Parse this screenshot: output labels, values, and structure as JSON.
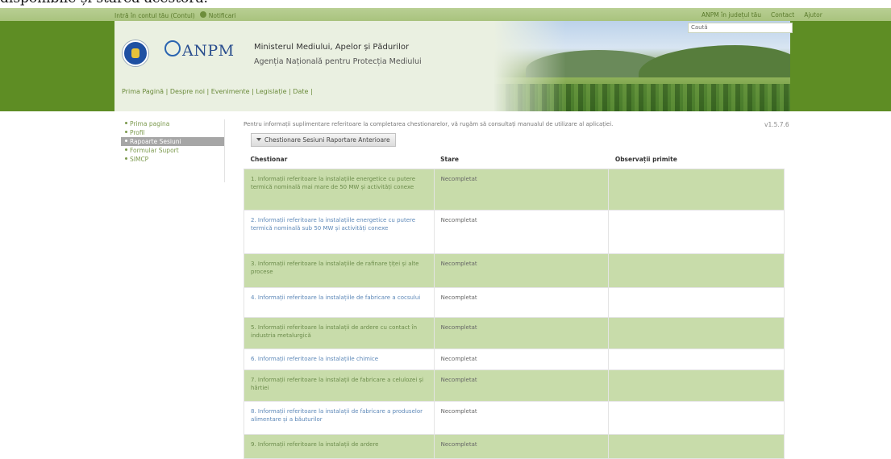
{
  "cut_caption": "disponibile și starea acestora.",
  "topbar": {
    "left_link": "Intră în contul tău (Contul)",
    "notifications": "Notificari",
    "right_links": [
      "ANPM în județul tău",
      "Contact",
      "Ajutor"
    ]
  },
  "header": {
    "logo_text": "ANPM",
    "ministry": "Ministerul Mediului, Apelor și Pădurilor",
    "agency": "Agenția Națională pentru Protecția Mediului",
    "nav": [
      "Prima Pagină",
      "Despre noi",
      "Evenimente",
      "Legislație",
      "Date"
    ],
    "search_placeholder": "Caută"
  },
  "sidebar": {
    "items": [
      {
        "label": "Prima pagina",
        "active": false
      },
      {
        "label": "Profil",
        "active": false
      },
      {
        "label": "Rapoarte Sesiuni",
        "active": true
      },
      {
        "label": "Formular Suport",
        "active": false
      },
      {
        "label": "SIMCP",
        "active": false
      }
    ]
  },
  "main": {
    "info_text": "Pentru informații suplimentare referitoare la completarea chestionarelor, vă rugăm să consultați manualul de utilizare al aplicației.",
    "version": "v1.5.7.6",
    "tab_button": "Chestionare Sesiuni Raportare Anterioare",
    "columns": [
      "Chestionar",
      "Stare",
      "Observații primite"
    ],
    "rows": [
      {
        "q": "1. Informații referitoare la instalațiile energetice cu putere termică nominală mai mare de 50 MW și activități conexe",
        "status": "Necompletat"
      },
      {
        "q": "2. Informații referitoare la instalațiile energetice cu putere termică nominală sub 50 MW și activități conexe",
        "status": "Necompletat"
      },
      {
        "q": "3. Informații referitoare la instalațiile de rafinare țiței și alte procese",
        "status": "Necompletat"
      },
      {
        "q": "4. Informații referitoare la instalațiile de fabricare a cocsului",
        "status": "Necompletat"
      },
      {
        "q": "5. Informații referitoare la instalații de ardere cu contact în industria metalurgică",
        "status": "Necompletat"
      },
      {
        "q": "6. Informații referitoare la instalațiile chimice",
        "status": "Necompletat"
      },
      {
        "q": "7. Informații referitoare la instalații de fabricare a celulozei și hârtiei",
        "status": "Necompletat"
      },
      {
        "q": "8. Informații referitoare la instalații de fabricare a produselor alimentare și a băuturilor",
        "status": "Necompletat"
      },
      {
        "q": "9. Informații referitoare la instalații de ardere",
        "status": "Necompletat"
      }
    ]
  }
}
